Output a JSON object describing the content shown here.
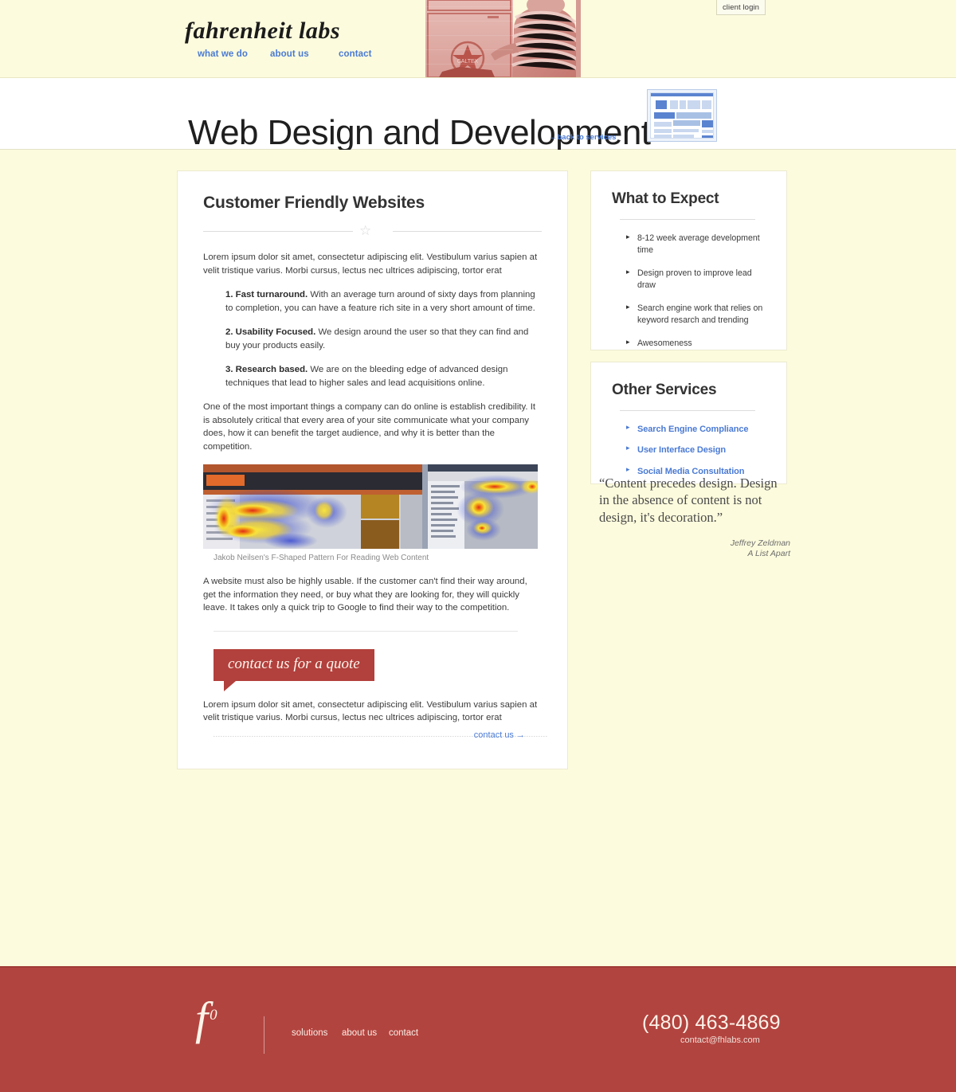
{
  "header": {
    "client_login_label": "client login",
    "brand": "fahrenheit labs",
    "nav": [
      {
        "label": "what we do"
      },
      {
        "label": "about us"
      },
      {
        "label": "contact"
      }
    ],
    "hero_photo_name": "vintage-caltex-photo"
  },
  "title_bar": {
    "page_title": "Web Design and Development",
    "back_link": "←back to services",
    "thumb_name": "web-page-mockup-icon"
  },
  "main": {
    "section_title": "Customer Friendly Websites",
    "intro": "Lorem ipsum dolor sit amet, consectetur adipiscing elit. Vestibulum varius sapien at velit tristique varius. Morbi cursus, lectus nec ultrices adipiscing, tortor erat",
    "points": [
      {
        "lead": "1. Fast turnaround.",
        "text": "With an average turn around of sixty days from planning to completion, you can have a feature rich site in a very short amount of time."
      },
      {
        "lead": "2. Usability Focused.",
        "text": "We design around the user so that they can find and buy your products easily."
      },
      {
        "lead": "3. Research based.",
        "text": "We are on the bleeding edge of advanced design techniques that lead to higher sales and lead acquisitions online."
      }
    ],
    "paragraph_2": "One of the most important things a company can do online is establish credibility. It is absolutely critical that every area of your site communicate what your company does, how it can benefit the target audience, and why it is better than the competition.",
    "figure_caption": "Jakob Neilsen's F-Shaped Pattern For Reading Web Content",
    "figure_name": "f-shaped-heatmap-image",
    "paragraph_3": "A website must also be highly usable. If the customer can't find their way around, get the information they need, or buy what they are looking for, they will quickly leave. It takes only a quick trip to Google to find their way to the competition.",
    "quote_button": "contact us for a quote",
    "paragraph_4": "Lorem ipsum dolor sit amet, consectetur adipiscing elit. Vestibulum varius sapien at velit tristique varius. Morbi cursus, lectus nec ultrices adipiscing, tortor erat",
    "contact_link": "contact us →"
  },
  "sidebar": {
    "expect": {
      "title": "What to Expect",
      "items": [
        {
          "label": "8-12 week average development time"
        },
        {
          "label": "Design proven to improve lead draw"
        },
        {
          "label": "Search engine work that relies on keyword resarch and trending"
        },
        {
          "label": "Awesomeness"
        }
      ]
    },
    "other_services": {
      "title": "Other Services",
      "items": [
        {
          "label": "Search Engine Compliance"
        },
        {
          "label": "User Interface Design"
        },
        {
          "label": "Social Media Consultation"
        }
      ]
    },
    "pullquote": {
      "text": "“Content precedes design. Design in the absence of content is not design, it's decoration.”",
      "author": "Jeffrey Zeldman",
      "source": "A List Apart"
    }
  },
  "footer": {
    "logo_mark": "f",
    "logo_sup": "0",
    "nav": [
      {
        "label": "solutions"
      },
      {
        "label": "about us"
      },
      {
        "label": "contact"
      }
    ],
    "phone": "(480) 463-4869",
    "email": "contact@fhlabs.com"
  },
  "colors": {
    "page_bg": "#fcfbdd",
    "card_bg": "#ffffff",
    "link_blue": "#4a7ad4",
    "brand_red": "#b2443f",
    "text": "#3c3c3c"
  }
}
